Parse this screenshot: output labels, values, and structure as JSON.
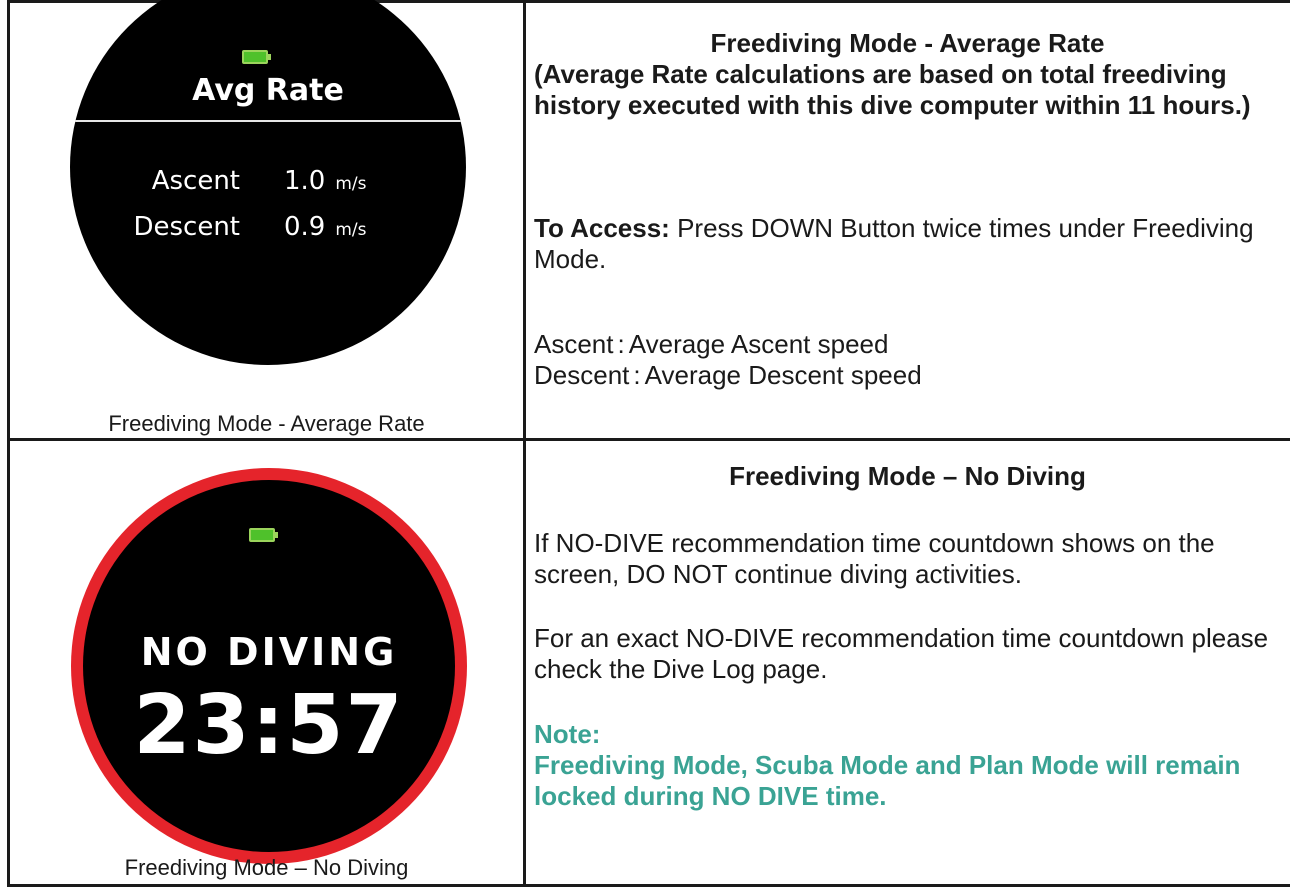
{
  "row1": {
    "caption": "Freediving Mode - Average Rate",
    "watch": {
      "title": "Avg Rate",
      "ascent_label": "Ascent",
      "ascent_value": "1.0",
      "descent_label": "Descent",
      "descent_value": "0.9",
      "unit": "m/s"
    },
    "heading": "Freediving Mode - Average Rate",
    "subheading": "(Average Rate calculations are based on total freediving history executed with this dive computer within 11 hours.)",
    "access_label": "To Access:",
    "access_text": "Press DOWN Button twice times under Freediving Mode.",
    "ascent_term": "Ascent",
    "ascent_desc": "Average Ascent speed",
    "descent_term": "Descent",
    "descent_desc": "Average Descent speed",
    "separator": ":"
  },
  "row2": {
    "caption": "Freediving Mode – No Diving",
    "watch": {
      "label": "NO DIVING",
      "timer": "23:57"
    },
    "heading": "Freediving Mode – No Diving",
    "para1": "If NO-DIVE recommendation time countdown shows on the screen, DO NOT continue diving activities.",
    "para2": "For an exact NO-DIVE recommendation time countdown please check the Dive Log page.",
    "note_label": "Note:",
    "note_text": "Freediving Mode, Scuba Mode and Plan Mode will remain locked during NO DIVE time."
  },
  "colors": {
    "note": "#3aa394",
    "ring": "#e5242b",
    "battery": "#4fc12b"
  }
}
